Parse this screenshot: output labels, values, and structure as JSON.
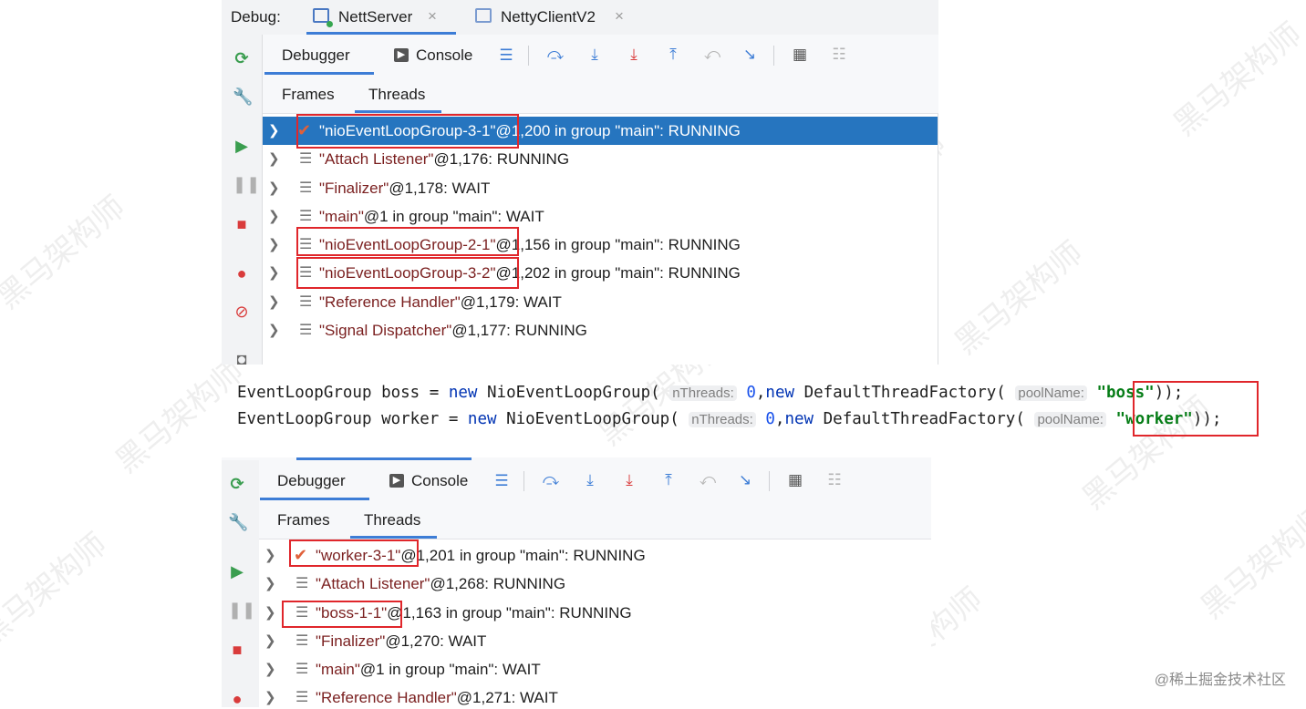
{
  "top_panel": {
    "debug_label": "Debug:",
    "tabs": [
      {
        "label": "NettServer"
      },
      {
        "label": "NettyClientV2"
      }
    ],
    "close_glyph": "×",
    "toolbar": {
      "debugger": "Debugger",
      "console": "Console"
    },
    "subtabs": {
      "frames": "Frames",
      "threads": "Threads"
    },
    "threads": [
      {
        "quoted": "\"nioEventLoopGroup-3-1\"",
        "rest": "@1,200 in group \"main\": RUNNING",
        "selected": true,
        "check": true
      },
      {
        "quoted": "\"Attach Listener\"",
        "rest": "@1,176: RUNNING"
      },
      {
        "quoted": "\"Finalizer\"",
        "rest": "@1,178: WAIT"
      },
      {
        "quoted": "\"main\"",
        "rest": "@1 in group \"main\": WAIT"
      },
      {
        "quoted": "\"nioEventLoopGroup-2-1\"",
        "rest": "@1,156 in group \"main\": RUNNING"
      },
      {
        "quoted": "\"nioEventLoopGroup-3-2\"",
        "rest": "@1,202 in group \"main\": RUNNING"
      },
      {
        "quoted": "\"Reference Handler\"",
        "rest": "@1,179: WAIT"
      },
      {
        "quoted": "\"Signal Dispatcher\"",
        "rest": "@1,177: RUNNING"
      }
    ]
  },
  "code": {
    "line1": {
      "type": "EventLoopGroup",
      "var": "boss",
      "eq": "=",
      "new": "new",
      "ctor": "NioEventLoopGroup(",
      "hint1": "nThreads:",
      "num": "0",
      "comma": ",",
      "new2": "new",
      "factory": "DefaultThreadFactory(",
      "hint2": "poolName:",
      "str": "\"boss\"",
      "end": "));"
    },
    "line2": {
      "type": "EventLoopGroup",
      "var": "worker",
      "eq": "=",
      "new": "new",
      "ctor": "NioEventLoopGroup(",
      "hint1": "nThreads:",
      "num": "0",
      "comma": ",",
      "new2": "new",
      "factory": "DefaultThreadFactory(",
      "hint2": "poolName:",
      "str": "\"worker\"",
      "end": "));"
    }
  },
  "bottom_panel": {
    "toolbar": {
      "debugger": "Debugger",
      "console": "Console"
    },
    "subtabs": {
      "frames": "Frames",
      "threads": "Threads"
    },
    "threads": [
      {
        "quoted": "\"worker-3-1\"",
        "rest": "@1,201 in group \"main\": RUNNING",
        "check": true
      },
      {
        "quoted": "\"Attach Listener\"",
        "rest": "@1,268: RUNNING"
      },
      {
        "quoted": "\"boss-1-1\"",
        "rest": "@1,163 in group \"main\": RUNNING"
      },
      {
        "quoted": "\"Finalizer\"",
        "rest": "@1,270: WAIT"
      },
      {
        "quoted": "\"main\"",
        "rest": "@1 in group \"main\": WAIT"
      },
      {
        "quoted": "\"Reference Handler\"",
        "rest": "@1,271: WAIT"
      }
    ]
  },
  "watermark": "黑马架构师",
  "footer": "@稀土掘金技术社区",
  "colors": {
    "selection": "#2675bf",
    "highlight_box": "#e0262b",
    "tab_underline": "#3d7dd6"
  }
}
